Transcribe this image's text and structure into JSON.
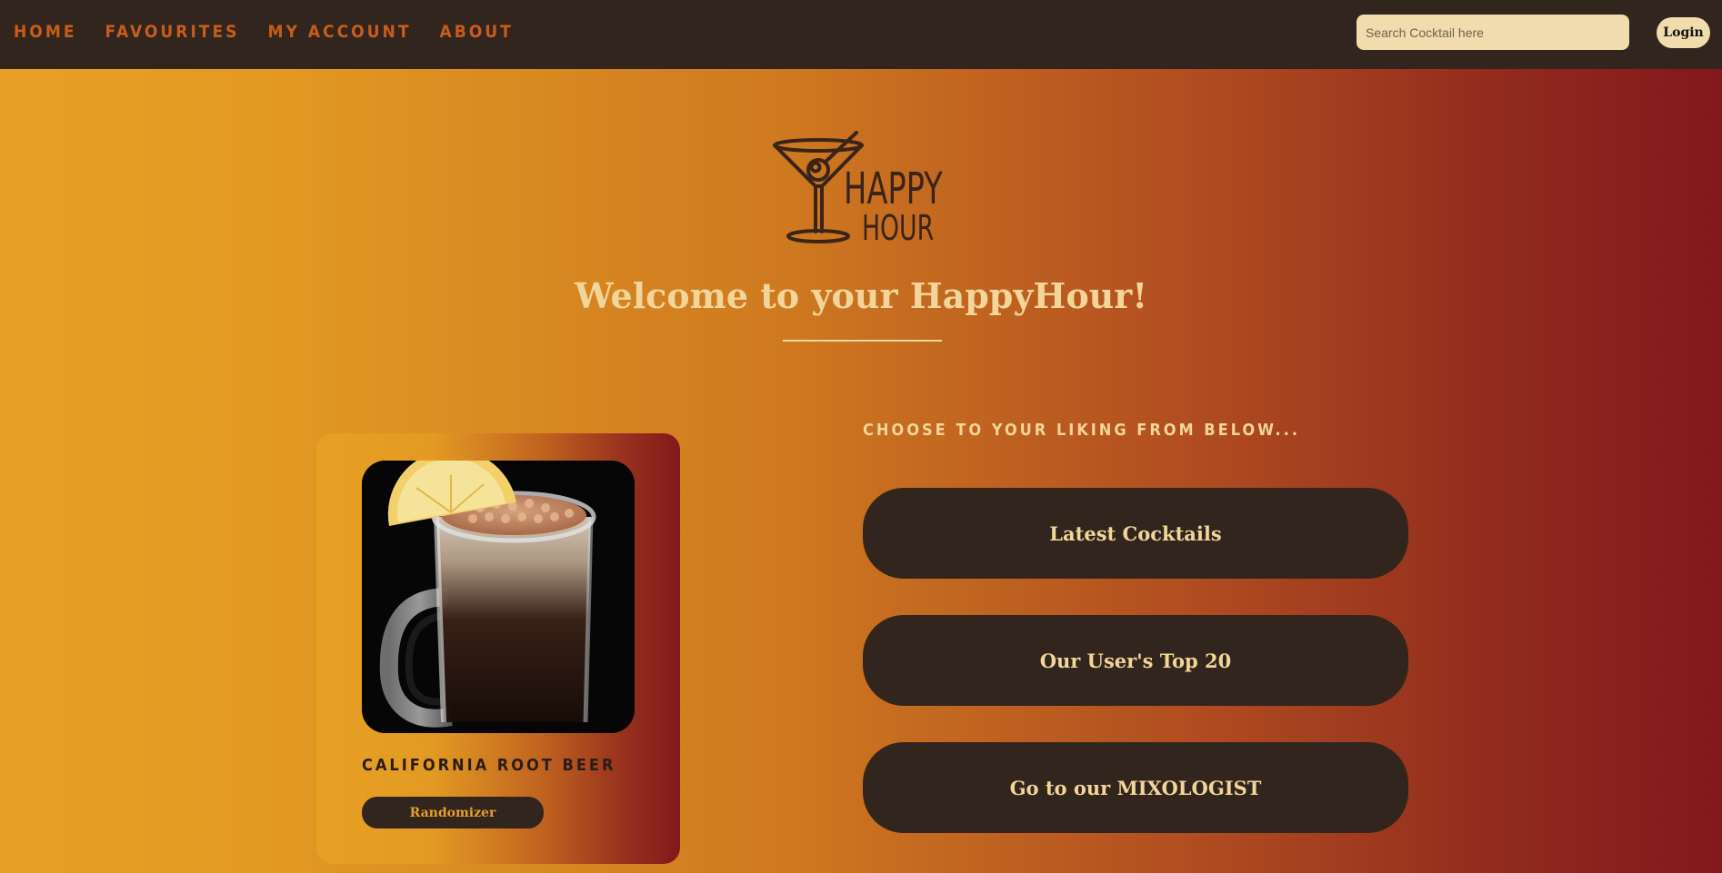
{
  "nav": {
    "items": [
      {
        "label": "HOME"
      },
      {
        "label": "FAVOURITES"
      },
      {
        "label": "MY ACCOUNT"
      },
      {
        "label": "ABOUT"
      }
    ]
  },
  "search": {
    "placeholder": "Search Cocktail here",
    "value": ""
  },
  "login": {
    "label": "Login"
  },
  "logo": {
    "line1": "HAPPY",
    "line2": "HOUR",
    "icon": "martini-glass-icon"
  },
  "welcome": {
    "title": "Welcome to your HappyHour!"
  },
  "card": {
    "image_icon": "root-beer-mug-photo",
    "title": "CALIFORNIA ROOT BEER",
    "button_label": "Randomizer"
  },
  "options": {
    "heading": "CHOOSE TO YOUR LIKING FROM BELOW...",
    "buttons": [
      {
        "label": "Latest Cocktails"
      },
      {
        "label": "Our User's Top 20"
      },
      {
        "label": "Go to our MIXOLOGIST"
      }
    ]
  },
  "colors": {
    "nav_background": "#32251e",
    "nav_link": "#c85d1a",
    "cream": "#f2d598",
    "gradient_start": "#e8a024",
    "gradient_end": "#82181c"
  }
}
